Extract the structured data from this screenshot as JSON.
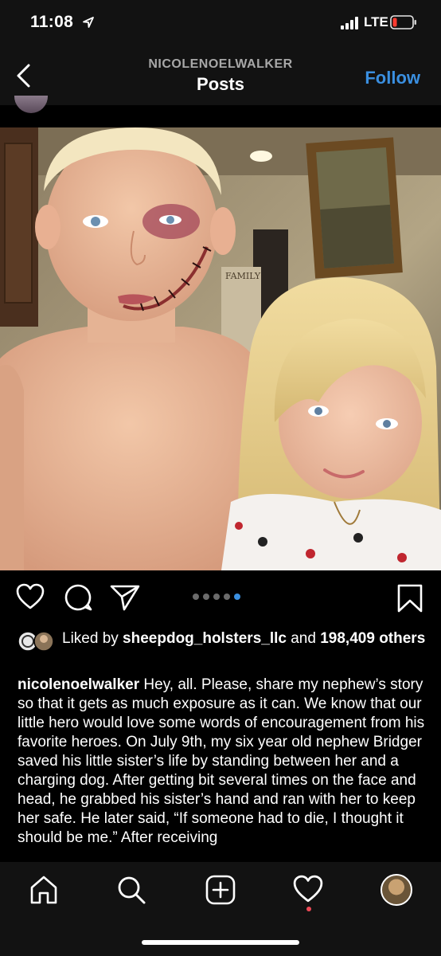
{
  "status_bar": {
    "time": "11:08",
    "network": "LTE"
  },
  "header": {
    "username": "NICOLENOELWALKER",
    "title": "Posts",
    "follow_label": "Follow"
  },
  "carousel": {
    "total_slides": 5,
    "active_index": 4
  },
  "likes": {
    "prefix": "Liked by ",
    "user": "sheepdog_holsters_llc",
    "connector": " and ",
    "count": "198,409",
    "suffix": "others"
  },
  "caption": {
    "username": "nicolenoelwalker",
    "text": " Hey, all.  Please, share my nephew’s story so that it gets as much exposure as it can.  We know that our little hero would love some words of encouragement from his favorite heroes. On July 9th, my six year old nephew Bridger saved his little sister’s life by standing between her and a charging dog.  After getting bit several times on the face and head, he grabbed his sister’s hand and ran with her to keep her safe.  He later said, “If someone had to die, I thought it should be me.” After receiving"
  },
  "icons": {
    "location": "location-arrow-icon",
    "signal": "signal-bars-icon",
    "battery": "battery-low-icon",
    "back": "chevron-left-icon",
    "like": "heart-icon",
    "comment": "comment-bubble-icon",
    "share": "paper-plane-icon",
    "save": "bookmark-icon",
    "home": "home-icon",
    "search": "search-icon",
    "add": "plus-square-icon",
    "activity": "heart-icon",
    "profile": "profile-avatar"
  },
  "colors": {
    "accent": "#3a8fe0",
    "battery_low": "#ff3b30",
    "notification": "#ed4956",
    "background": "#000000",
    "bar": "#121212"
  }
}
